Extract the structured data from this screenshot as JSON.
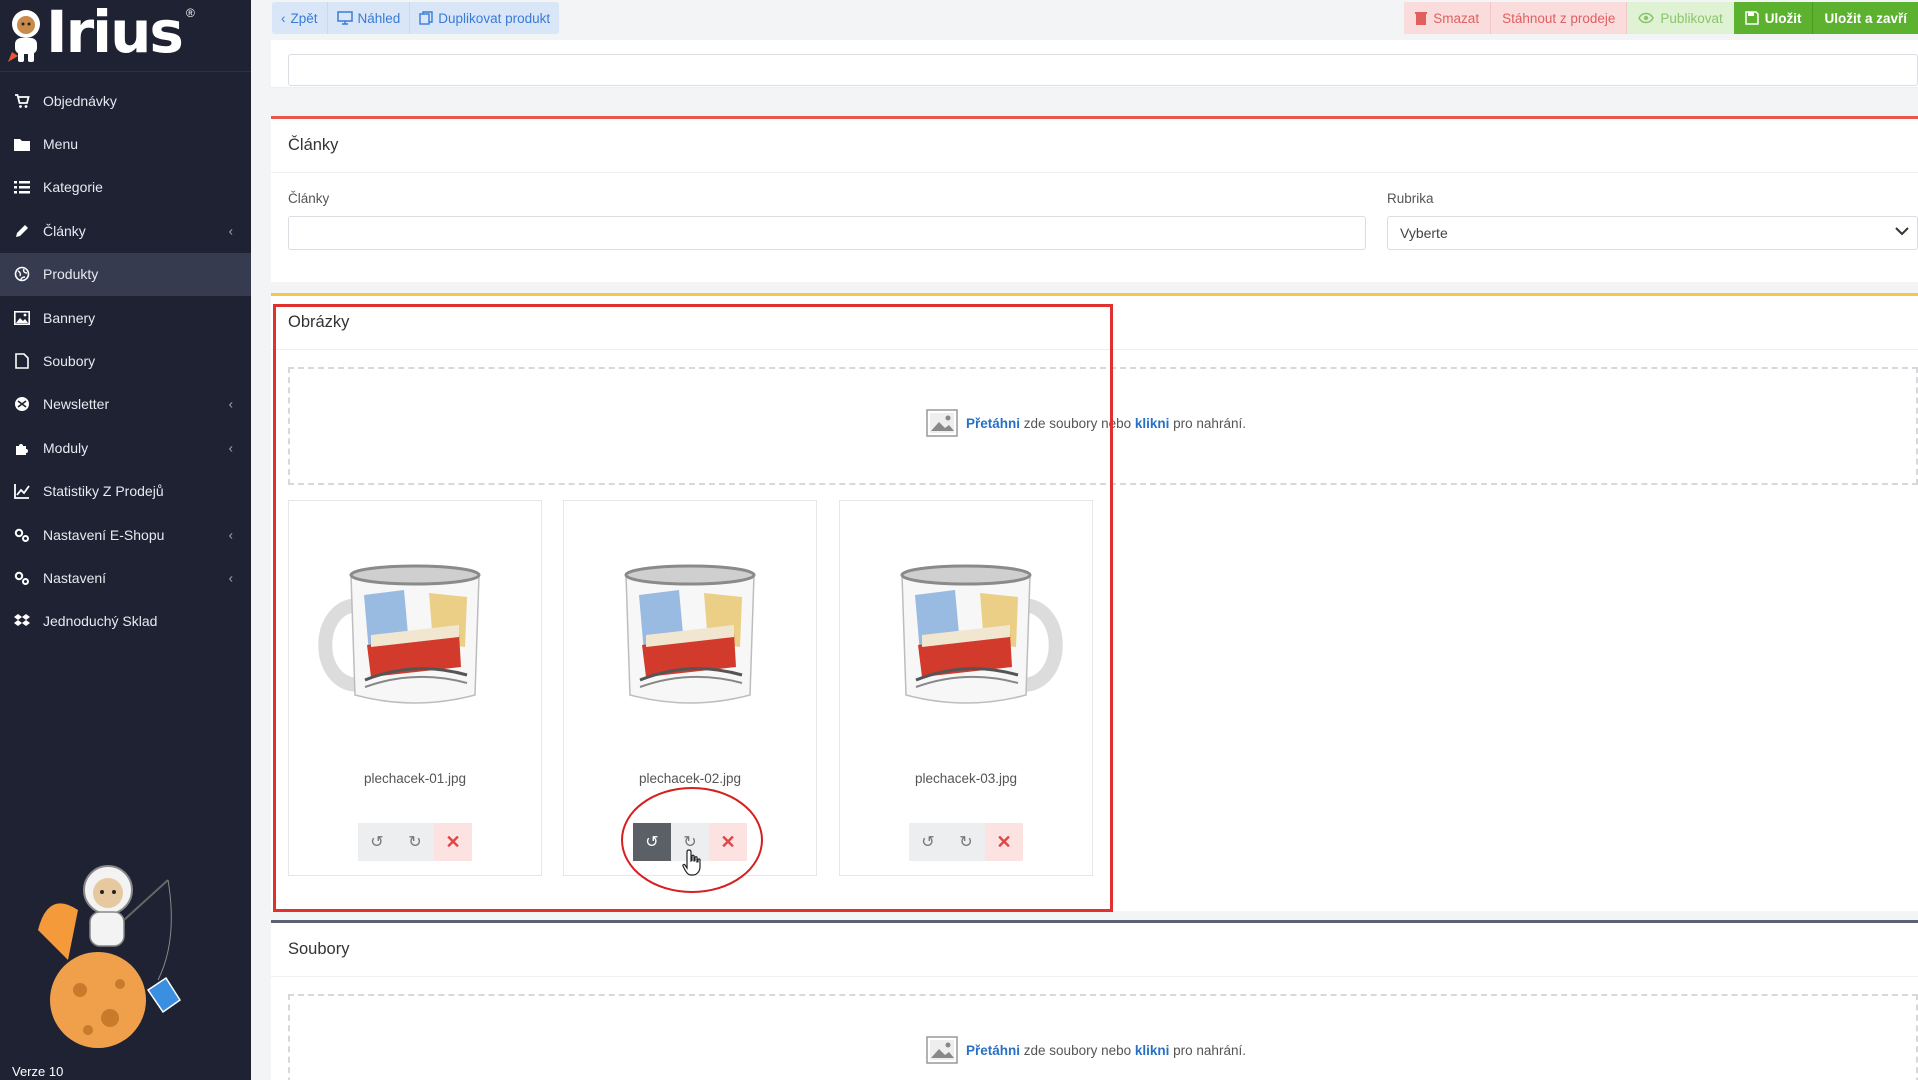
{
  "app": {
    "logo_text": "Irius",
    "logo_reg": "®",
    "version": "Verze 10"
  },
  "sidebar": {
    "items": [
      {
        "label": "Objednávky",
        "icon": "cart-icon",
        "has_chevron": false
      },
      {
        "label": "Menu",
        "icon": "folder-icon",
        "has_chevron": false
      },
      {
        "label": "Kategorie",
        "icon": "list-icon",
        "has_chevron": false
      },
      {
        "label": "Články",
        "icon": "pencil-icon",
        "has_chevron": true
      },
      {
        "label": "Produkty",
        "icon": "globe-icon",
        "has_chevron": false,
        "active": true
      },
      {
        "label": "Bannery",
        "icon": "image-icon",
        "has_chevron": false
      },
      {
        "label": "Soubory",
        "icon": "file-icon",
        "has_chevron": false
      },
      {
        "label": "Newsletter",
        "icon": "envelope-icon",
        "has_chevron": true
      },
      {
        "label": "Moduly",
        "icon": "puzzle-icon",
        "has_chevron": true
      },
      {
        "label": "Statistiky Z Prodejů",
        "icon": "chart-icon",
        "has_chevron": false
      },
      {
        "label": "Nastavení E-Shopu",
        "icon": "cogs-icon",
        "has_chevron": true
      },
      {
        "label": "Nastavení",
        "icon": "cogs-icon",
        "has_chevron": true
      },
      {
        "label": "Jednoduchý Sklad",
        "icon": "dropbox-icon",
        "has_chevron": false
      }
    ]
  },
  "toolbar": {
    "back_label": "Zpět",
    "preview_label": "Náhled",
    "duplicate_label": "Duplikovat produkt",
    "delete_label": "Smazat",
    "withdraw_label": "Stáhnout z prodeje",
    "publish_label": "Publikovat",
    "save_label": "Uložit",
    "save_close_label": "Uložit a zavří"
  },
  "articles": {
    "title": "Články",
    "field_label": "Články",
    "field_value": "",
    "category_label": "Rubrika",
    "category_selected": "Vyberte"
  },
  "images": {
    "title": "Obrázky",
    "dropzone": {
      "drag": "Přetáhni",
      "middle": "zde soubory nebo",
      "click": "klikni",
      "end": "pro nahrání."
    },
    "files": [
      {
        "name": "plechacek-01.jpg",
        "handle": "left"
      },
      {
        "name": "plechacek-02.jpg",
        "handle": "none"
      },
      {
        "name": "plechacek-03.jpg",
        "handle": "right"
      }
    ]
  },
  "files": {
    "title": "Soubory",
    "dropzone": {
      "drag": "Přetáhni",
      "middle": "zde soubory nebo",
      "click": "klikni",
      "end": "pro nahrání."
    }
  },
  "colors": {
    "sidebar_bg": "#1e2233",
    "accent_blue": "#2670c7",
    "save_green": "#5cb12e",
    "danger_red": "#e04646",
    "highlight_red": "#e03030"
  }
}
